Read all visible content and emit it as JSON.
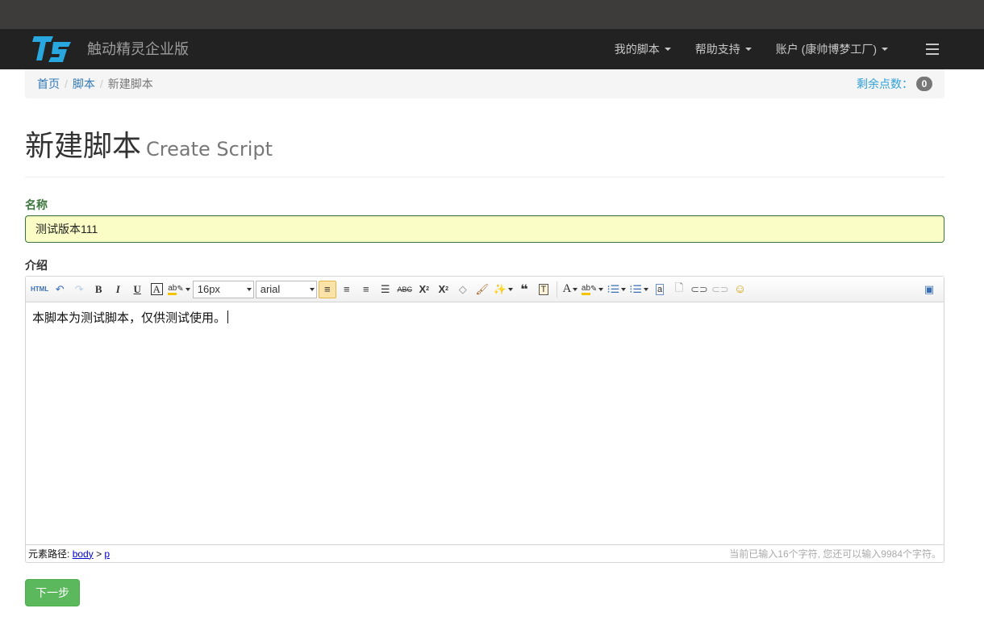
{
  "app": {
    "brand_title": "触动精灵企业版",
    "brand_color": "#29a8e0"
  },
  "nav": {
    "my_scripts": "我的脚本",
    "help_support": "帮助支持",
    "account": "账户 (康帅博梦工厂)"
  },
  "breadcrumb": {
    "home": "首页",
    "scripts": "脚本",
    "current": "新建脚本",
    "points_label": "剩余点数：",
    "points_value": "0"
  },
  "page": {
    "title": "新建脚本",
    "subtitle": "Create Script"
  },
  "form": {
    "name_label": "名称",
    "name_value": "测试版本111",
    "desc_label": "介绍",
    "next_button": "下一步"
  },
  "editor": {
    "font_size": "16px",
    "font_family": "arial",
    "content": "本脚本为测试脚本，仅供测试使用。",
    "path_label": "元素路径:",
    "path_body": "body",
    "path_sep": ">",
    "path_p": "p",
    "char_count": "当前已输入16个字符, 您还可以输入9984个字符。",
    "toolbar_icons": [
      "html-source-icon",
      "undo-icon",
      "redo-icon",
      "bold-icon",
      "italic-icon",
      "underline-icon",
      "font-border-icon",
      "backcolor-icon",
      "fontsize-select",
      "fontfamily-select",
      "align-left-icon",
      "align-right-icon",
      "align-center-icon",
      "align-justify-icon",
      "strikethrough-icon",
      "superscript-icon",
      "subscript-icon",
      "eraser-icon",
      "format-brush-icon",
      "autotypeset-icon",
      "blockquote-icon",
      "paste-plain-icon",
      "forecolor-icon",
      "highlight-icon",
      "ordered-list-icon",
      "unordered-list-icon",
      "anchor-icon",
      "page-icon",
      "link-icon",
      "unlink-icon",
      "emotion-icon",
      "fullscreen-icon"
    ]
  }
}
